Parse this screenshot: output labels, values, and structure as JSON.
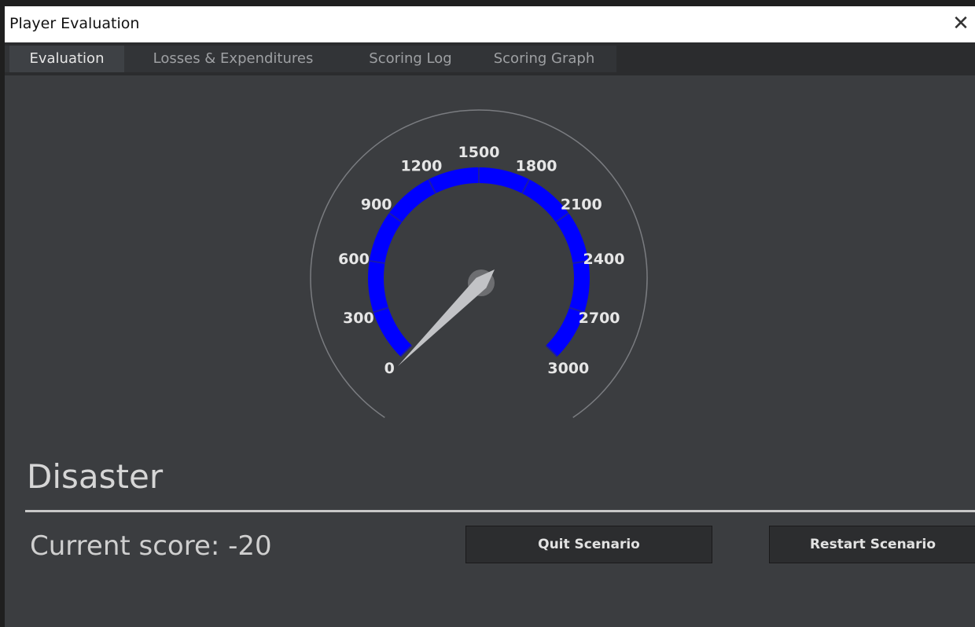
{
  "window": {
    "title": "Player Evaluation"
  },
  "tabs": [
    {
      "label": "Evaluation",
      "active": true
    },
    {
      "label": "Losses & Expenditures",
      "active": false
    },
    {
      "label": "Scoring Log",
      "active": false
    },
    {
      "label": "Scoring Graph",
      "active": false
    }
  ],
  "gauge": {
    "min": 0,
    "max": 3000,
    "ticks": [
      "0",
      "300",
      "600",
      "900",
      "1200",
      "1500",
      "1800",
      "2100",
      "2400",
      "2700",
      "3000"
    ],
    "arc_color": "#0000ff",
    "value": -20
  },
  "evaluation": {
    "rating": "Disaster",
    "score_text": "Current score: -20"
  },
  "buttons": {
    "quit": "Quit Scenario",
    "restart": "Restart Scenario"
  }
}
